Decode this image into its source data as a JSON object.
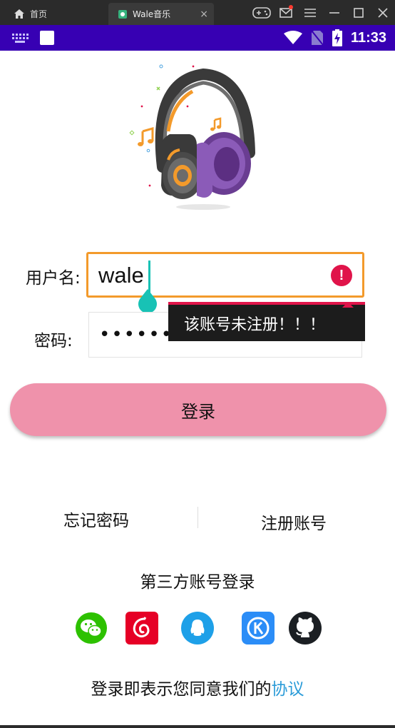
{
  "window": {
    "home_tab": "首页",
    "app_tab": "Wale音乐",
    "tab_close": "×"
  },
  "statusbar": {
    "time": "11:33"
  },
  "form": {
    "username_label": "用户名:",
    "username_value": "wale",
    "password_label": "密码:",
    "password_value": "••••••",
    "error_icon": "!",
    "error_message": "该账号未注册！！！",
    "login_button": "登录"
  },
  "links": {
    "forgot_password": "忘记密码",
    "register": "注册账号"
  },
  "third_party": {
    "title": "第三方账号登录",
    "icons": [
      "wechat-icon",
      "netease-music-icon",
      "qq-icon",
      "kugou-icon",
      "github-icon"
    ]
  },
  "agreement": {
    "prefix": "登录即表示您同意我们的",
    "link": "协议"
  },
  "colors": {
    "statusbar": "#3700b3",
    "input_focus": "#f39a2b",
    "error": "#e0144a",
    "login_button": "#ef92ab",
    "link": "#2a9bd8",
    "cursor": "#18c2b5"
  }
}
